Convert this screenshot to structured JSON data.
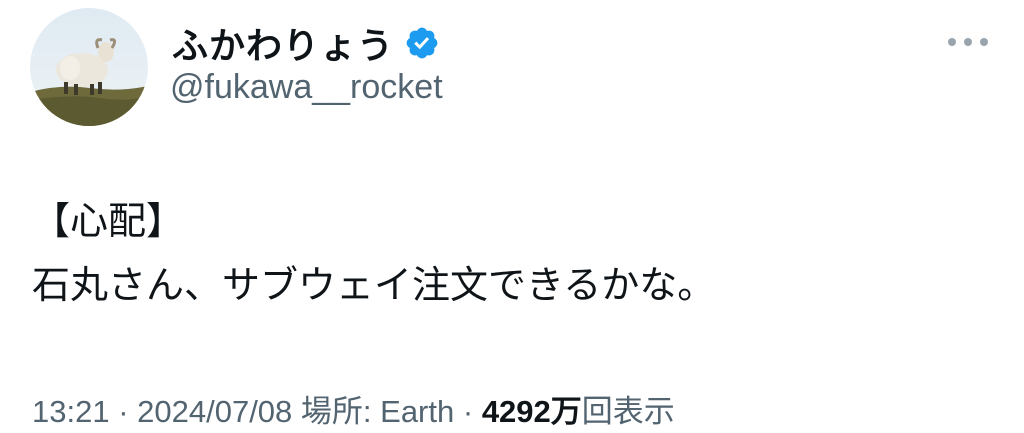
{
  "user": {
    "display_name": "ふかわりょう",
    "handle": "@fukawa__rocket",
    "verified": true
  },
  "icons": {
    "avatar": "sheep-avatar",
    "verified": "verified-badge-icon",
    "more": "more-options-icon"
  },
  "colors": {
    "verified_badge": "#1d9bf0",
    "secondary_text": "#536471",
    "primary_text": "#0f1419"
  },
  "tweet": {
    "lines": [
      "【心配】",
      "石丸さん、サブウェイ注文できるかな。"
    ]
  },
  "meta": {
    "time": "13:21",
    "sep1": " · ",
    "date": "2024/07/08",
    "location_label": " 場所: ",
    "location": "Earth",
    "sep2": " · ",
    "views_count": "4292",
    "views_unit": "万",
    "views_label": "回表示"
  }
}
